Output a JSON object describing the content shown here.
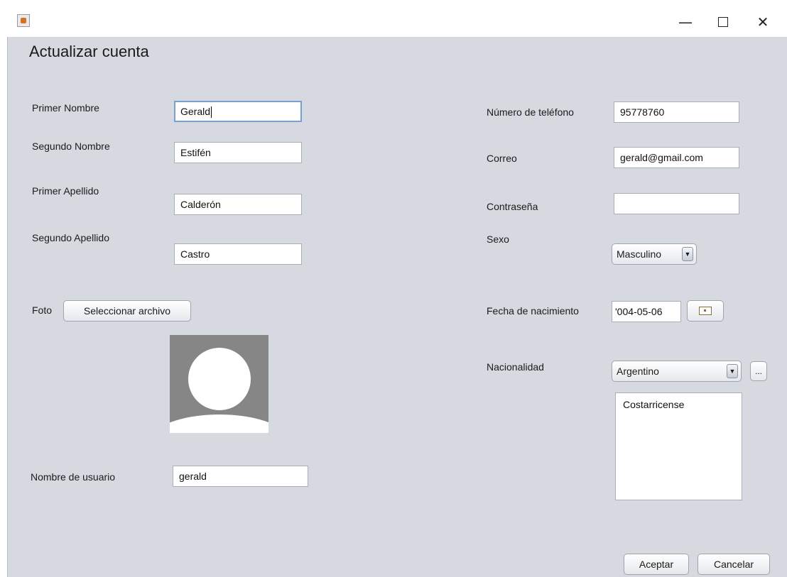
{
  "window": {
    "minimize_glyph": "—",
    "close_glyph": "✕"
  },
  "form": {
    "title": "Actualizar cuenta",
    "left": {
      "primer_nombre": {
        "label": "Primer Nombre",
        "value": "Gerald"
      },
      "segundo_nombre": {
        "label": "Segundo Nombre",
        "value": "Estifén"
      },
      "primer_apellido": {
        "label": "Primer Apellido",
        "value": "Calderón"
      },
      "segundo_apellido": {
        "label": "Segundo Apellido",
        "value": "Castro"
      },
      "foto": {
        "label": "Foto",
        "button_label": "Seleccionar archivo"
      },
      "usuario": {
        "label": "Nombre de usuario",
        "value": "gerald"
      }
    },
    "right": {
      "telefono": {
        "label": "Número de teléfono",
        "value": "95778760"
      },
      "correo": {
        "label": "Correo",
        "value": "gerald@gmail.com"
      },
      "contrasena": {
        "label": "Contraseña",
        "value": ""
      },
      "sexo": {
        "label": "Sexo",
        "selected": "Masculino"
      },
      "fecha": {
        "label": "Fecha de nacimiento",
        "value": "'004-05-06"
      },
      "nacionalidad": {
        "label": "Nacionalidad",
        "selected": "Argentino",
        "more_label": "...",
        "list_items": [
          "Costarricense"
        ]
      }
    },
    "buttons": {
      "accept": "Aceptar",
      "cancel": "Cancelar"
    },
    "arrow_glyph": "▼"
  },
  "icons": {
    "app": "java-cup-icon",
    "calendar": "calendar-icon",
    "avatar": "user-avatar-placeholder"
  }
}
